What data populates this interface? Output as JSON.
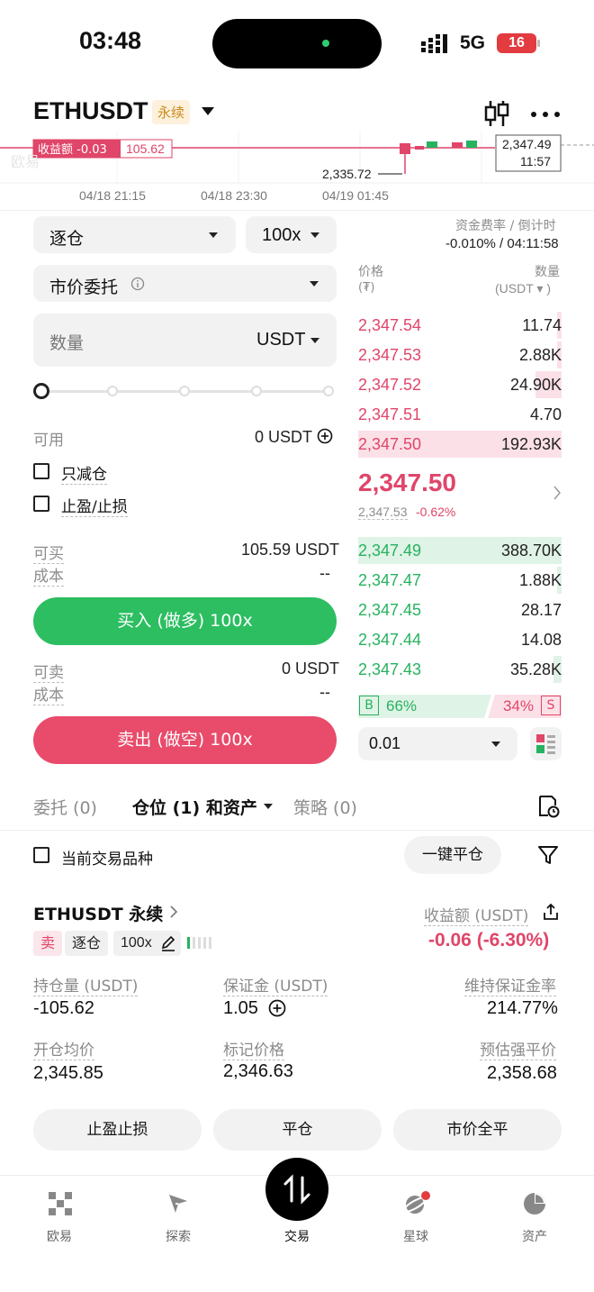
{
  "status_bar": {
    "time": "03:48",
    "network": "5G",
    "battery": "16"
  },
  "header": {
    "symbol": "ETHUSDT",
    "perp_badge": "永续"
  },
  "chart": {
    "pnl_label": "收益额 -0.03",
    "position_price": "105.62",
    "low_label": "2,335.72",
    "crosshair_price": "2,347.49",
    "crosshair_time": "11:57",
    "watermark": "欧易",
    "time_axis": [
      "04/18 21:15",
      "04/18 23:30",
      "04/19 01:45"
    ]
  },
  "funding": {
    "label": "资金费率 / 倒计时",
    "value": "-0.010% / 04:11:58"
  },
  "form": {
    "margin_mode": "逐仓",
    "leverage": "100x",
    "order_type": "市价委托",
    "amount_placeholder": "数量",
    "amount_unit": "USDT",
    "available_label": "可用",
    "available_value": "0 USDT",
    "reduce_only": "只减仓",
    "tp_sl": "止盈/止损",
    "can_buy_label": "可买",
    "can_buy_value": "105.59 USDT",
    "cost_label": "成本",
    "cost_value": "--",
    "buy_button": "买入 (做多) 100x",
    "can_sell_label": "可卖",
    "can_sell_value": "0 USDT",
    "cost_label2": "成本",
    "cost_value2": "--",
    "sell_button": "卖出 (做空) 100x"
  },
  "orderbook": {
    "price_header": "价格",
    "price_unit": "(₮)",
    "qty_header": "数量",
    "qty_unit": "(USDT ▾ )",
    "asks": [
      {
        "price": "2,347.54",
        "qty": "11.74",
        "depth": 0.02
      },
      {
        "price": "2,347.53",
        "qty": "2.88K",
        "depth": 0.02
      },
      {
        "price": "2,347.52",
        "qty": "24.90K",
        "depth": 0.13
      },
      {
        "price": "2,347.51",
        "qty": "4.70",
        "depth": 0.0
      },
      {
        "price": "2,347.50",
        "qty": "192.93K",
        "depth": 1.0
      }
    ],
    "mid_price": "2,347.50",
    "mark_price": "2,347.53",
    "change": "-0.62%",
    "bids": [
      {
        "price": "2,347.49",
        "qty": "388.70K",
        "depth": 1.0
      },
      {
        "price": "2,347.47",
        "qty": "1.88K",
        "depth": 0.02
      },
      {
        "price": "2,347.45",
        "qty": "28.17",
        "depth": 0.0
      },
      {
        "price": "2,347.44",
        "qty": "14.08",
        "depth": 0.0
      },
      {
        "price": "2,347.43",
        "qty": "35.28K",
        "depth": 0.04
      }
    ],
    "buy_letter": "B",
    "buy_ratio": "66%",
    "sell_ratio": "34%",
    "sell_letter": "S",
    "precision": "0.01"
  },
  "tabs": {
    "orders": "委托 (0)",
    "positions": "仓位 (1) 和资产",
    "strategies": "策略 (0)"
  },
  "filter": {
    "current_symbol": "当前交易品种",
    "close_all": "一键平仓"
  },
  "position": {
    "title": "ETHUSDT 永续",
    "pnl_label": "收益额 (USDT)",
    "pnl_value": "-0.06 (-6.30%)",
    "side_tag": "卖",
    "mode_tag": "逐仓",
    "lev_tag": "100x",
    "size_label": "持仓量 (USDT)",
    "size_value": "-105.62",
    "margin_label": "保证金 (USDT)",
    "margin_value": "1.05",
    "mmr_label": "维持保证金率",
    "mmr_value": "214.77%",
    "entry_label": "开仓均价",
    "entry_value": "2,345.85",
    "mark_label": "标记价格",
    "mark_value": "2,346.63",
    "liq_label": "预估强平价",
    "liq_value": "2,358.68",
    "btn_tpsl": "止盈止损",
    "btn_close": "平仓",
    "btn_market_close": "市价全平"
  },
  "nav": {
    "home": "欧易",
    "explore": "探索",
    "trade": "交易",
    "planet": "星球",
    "assets": "资产"
  },
  "colors": {
    "up": "#27b25f",
    "down": "#e0456a",
    "accent": "#000000"
  }
}
